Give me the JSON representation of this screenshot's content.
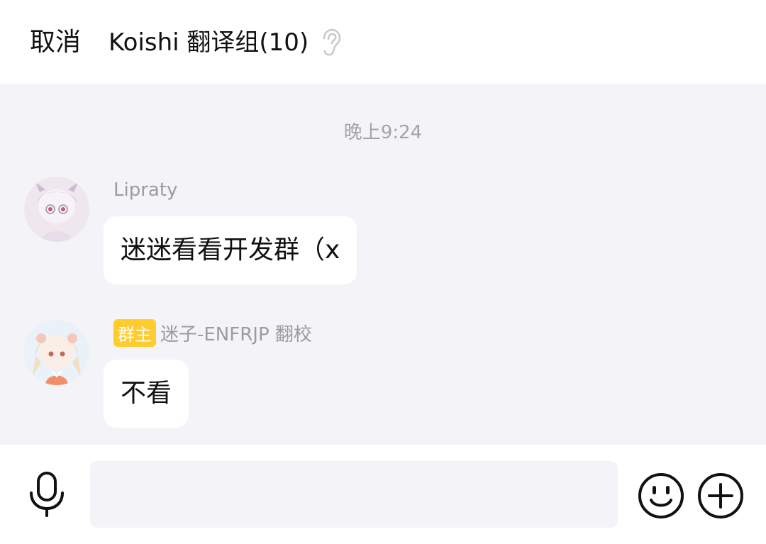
{
  "header": {
    "cancel_label": "取消",
    "title": "Koishi 翻译组(10)",
    "ear_icon": "ear-icon"
  },
  "chat": {
    "timestamp": "晚上9:24",
    "messages": [
      {
        "sender": "Lipraty",
        "badge": "",
        "text": "迷迷看看开发群（x",
        "avatar_icon": "anime-girl-avatar"
      },
      {
        "sender": "迷子-ENFRJP 翻校",
        "badge": "群主",
        "text": "不看",
        "avatar_icon": "anime-girl-avatar"
      }
    ]
  },
  "input": {
    "placeholder": "",
    "mic_icon": "microphone-icon",
    "emoji_icon": "smiley-icon",
    "plus_icon": "plus-icon"
  },
  "colors": {
    "chat_bg": "#f4f3f8",
    "badge_bg": "#ffcc2e",
    "bubble_bg": "#ffffff"
  }
}
